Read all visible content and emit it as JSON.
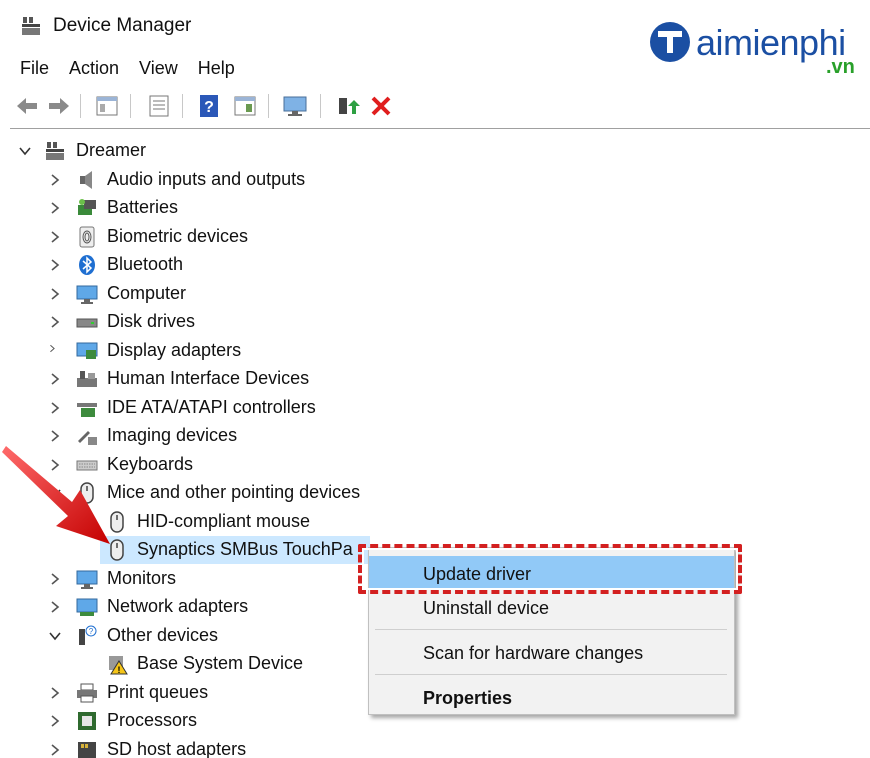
{
  "window": {
    "title": "Device Manager"
  },
  "logo": {
    "text": "aimienphi",
    "suffix": ".vn"
  },
  "menu": [
    "File",
    "Action",
    "View",
    "Help"
  ],
  "toolbar": {
    "icons": [
      "back-icon",
      "forward-icon",
      "properties-icon",
      "update-driver-icon",
      "help-icon",
      "view-icon",
      "monitor-icon",
      "enable-device-icon",
      "uninstall-icon"
    ]
  },
  "tree": {
    "root": "Dreamer",
    "items": [
      {
        "label": "Audio inputs and outputs",
        "icon": "speaker-icon"
      },
      {
        "label": "Batteries",
        "icon": "battery-icon"
      },
      {
        "label": "Biometric devices",
        "icon": "fingerprint-icon"
      },
      {
        "label": "Bluetooth",
        "icon": "bluetooth-icon"
      },
      {
        "label": "Computer",
        "icon": "computer-icon"
      },
      {
        "label": "Disk drives",
        "icon": "disk-icon"
      },
      {
        "label": "Display adapters",
        "icon": "display-adapter-icon"
      },
      {
        "label": "Human Interface Devices",
        "icon": "hid-icon"
      },
      {
        "label": "IDE ATA/ATAPI controllers",
        "icon": "ide-icon"
      },
      {
        "label": "Imaging devices",
        "icon": "camera-icon"
      },
      {
        "label": "Keyboards",
        "icon": "keyboard-icon"
      },
      {
        "label": "Mice and other pointing devices",
        "icon": "mouse-icon"
      },
      {
        "label": "HID-compliant mouse",
        "icon": "mouse-icon"
      },
      {
        "label": "Synaptics SMBus TouchPa",
        "icon": "mouse-icon"
      },
      {
        "label": "Monitors",
        "icon": "monitor-icon"
      },
      {
        "label": "Network adapters",
        "icon": "network-icon"
      },
      {
        "label": "Other devices",
        "icon": "unknown-device-icon"
      },
      {
        "label": "Base System Device",
        "icon": "warning-device-icon"
      },
      {
        "label": "Print queues",
        "icon": "printer-icon"
      },
      {
        "label": "Processors",
        "icon": "processor-icon"
      },
      {
        "label": "SD host adapters",
        "icon": "sd-card-icon"
      }
    ]
  },
  "context_menu": {
    "items": [
      "Update driver",
      "Uninstall device",
      "Scan for hardware changes",
      "Properties"
    ]
  },
  "colors": {
    "selection": "#cce8ff",
    "menu_highlight": "#91c9f7",
    "annotation_red": "#d32020",
    "logo_blue": "#1b4fa3",
    "logo_green": "#29a02a"
  }
}
